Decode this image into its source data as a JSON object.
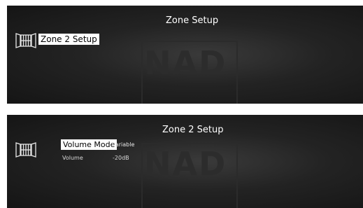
{
  "screens": [
    {
      "title": "Zone Setup",
      "watermark": "NAD",
      "icon": "zone-door-icon",
      "items": [
        {
          "label": "Zone 2 Setup",
          "selected": true
        }
      ]
    },
    {
      "title": "Zone 2 Setup",
      "watermark": "NAD",
      "icon": "zone-door-icon",
      "settings": [
        {
          "label": "Volume Mode",
          "value": "Variable",
          "selected": true
        },
        {
          "label": "Volume",
          "value": "-20dB",
          "selected": false
        }
      ]
    }
  ],
  "colors": {
    "background": "#1e1e1e",
    "text": "#ffffff",
    "highlight": "#ffffff",
    "highlight_text": "#000000"
  }
}
